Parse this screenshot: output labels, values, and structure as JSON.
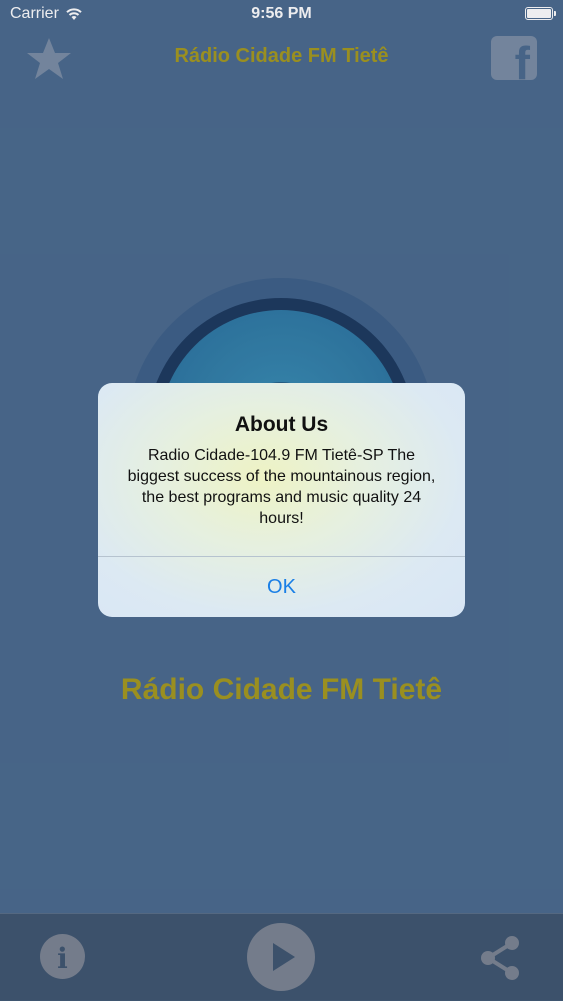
{
  "status_bar": {
    "carrier": "Carrier",
    "time": "9:56 PM"
  },
  "nav": {
    "title": "Rádio Cidade FM Tietê",
    "left_icon": "star-icon",
    "right_icon": "facebook-icon"
  },
  "main": {
    "station_name": "Rádio Cidade FM Tietê"
  },
  "toolbar": {
    "left_icon": "info-icon",
    "center_icon": "play-icon",
    "right_icon": "share-icon"
  },
  "alert": {
    "title": "About Us",
    "message": "Radio Cidade-104.9 FM Tietê-SP The biggest success of the mountainous region, the best programs and music quality 24 hours!",
    "button_label": "OK"
  },
  "colors": {
    "background": "#4b6b8f",
    "title_text": "#a59a1f",
    "toolbar": "#3f5670",
    "alert_button": "#1a7fe6"
  }
}
